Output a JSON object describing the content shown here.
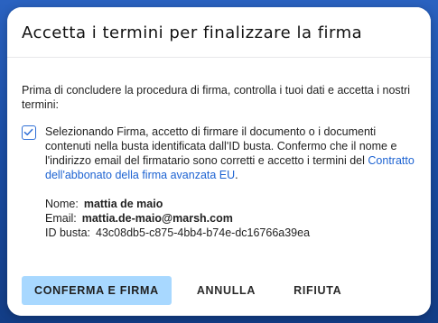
{
  "modal": {
    "title": "Accetta i termini per finalizzare la firma"
  },
  "body": {
    "intro": "Prima di concludere la procedura di firma, controlla i tuoi dati e accetta i nostri termini:",
    "consent_prefix": "Selezionando Firma, accetto di firmare il documento o i documenti contenuti nella busta identificata dall'ID busta. Confermo che il nome e l'indirizzo email del firmatario sono corretti e accetto i termini del ",
    "consent_link": "Contratto dell'abbonato della firma avanzata EU",
    "consent_suffix": ".",
    "checkbox_checked": true
  },
  "signer": {
    "name_label": "Nome:",
    "name_value": "mattia de maio",
    "email_label": "Email:",
    "email_value": "mattia.de-maio@marsh.com",
    "id_label": "ID busta:",
    "id_value": "43c08db5-c875-4bb4-b74e-dc16766a39ea"
  },
  "actions": {
    "confirm_label": "CONFERMA E FIRMA",
    "cancel_label": "ANNULLA",
    "decline_label": "RIFIUTA"
  },
  "colors": {
    "primary_button": "#a8d8ff",
    "link": "#1d63d2",
    "backdrop": "#1e4fa3"
  },
  "icons": {
    "checkbox_mark": "check-icon"
  }
}
